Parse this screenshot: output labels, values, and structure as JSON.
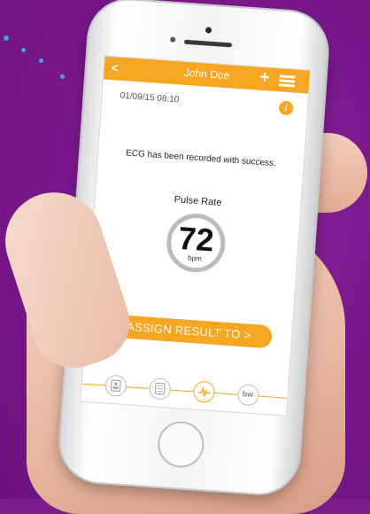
{
  "header": {
    "back_label": "<",
    "title": "John Doe",
    "add_label": "+"
  },
  "record": {
    "datetime": "01/09/15 08:10",
    "info_label": "i",
    "message": "ECG has been recorded with success."
  },
  "pulse": {
    "label": "Pulse Rate",
    "value": "72",
    "unit": "bpm"
  },
  "assign_button": {
    "label": "ASSIGN RESULT TO  >"
  },
  "tabbar": {
    "items": [
      {
        "icon": "profile-card-icon"
      },
      {
        "icon": "report-document-icon"
      },
      {
        "icon": "ecg-heartbeat-icon",
        "active": true
      },
      {
        "icon": "bw-logo-icon",
        "label": "bw"
      }
    ]
  },
  "colors": {
    "accent": "#f5a623",
    "background": "#7b1a8c",
    "dots": "#3fa7e8"
  }
}
